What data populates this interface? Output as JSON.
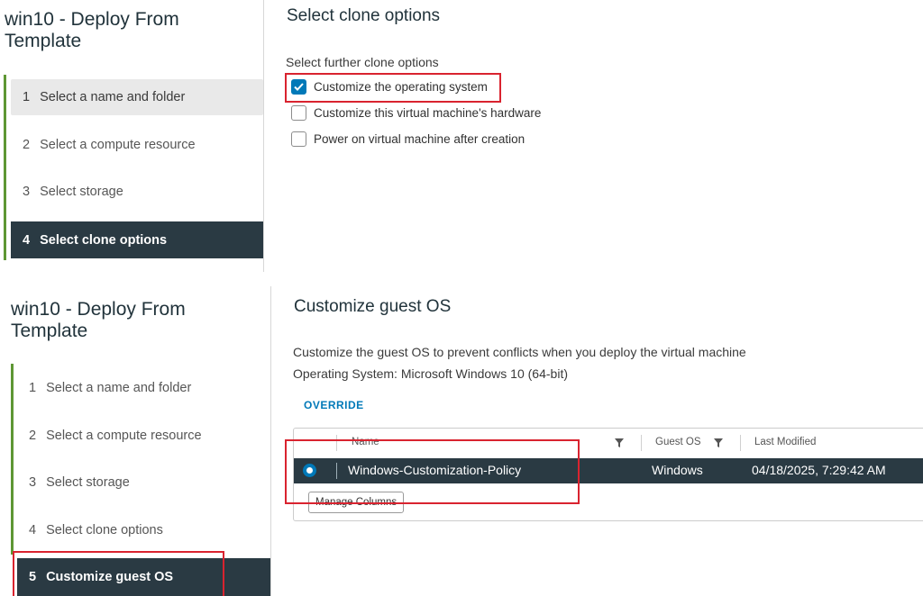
{
  "top": {
    "wizard_title_line1": "win10 - Deploy From",
    "wizard_title_line2": "Template",
    "steps": [
      {
        "num": "1",
        "label": "Select a name and folder"
      },
      {
        "num": "2",
        "label": "Select a compute resource"
      },
      {
        "num": "3",
        "label": "Select storage"
      },
      {
        "num": "4",
        "label": "Select clone options"
      }
    ],
    "section_title": "Select clone options",
    "subtitle": "Select further clone options",
    "options": [
      {
        "label": "Customize the operating system",
        "checked": true
      },
      {
        "label": "Customize this virtual machine's hardware",
        "checked": false
      },
      {
        "label": "Power on virtual machine after creation",
        "checked": false
      }
    ]
  },
  "bottom": {
    "wizard_title_line1": "win10 - Deploy From",
    "wizard_title_line2": "Template",
    "steps": [
      {
        "num": "1",
        "label": "Select a name and folder"
      },
      {
        "num": "2",
        "label": "Select a compute resource"
      },
      {
        "num": "3",
        "label": "Select storage"
      },
      {
        "num": "4",
        "label": "Select clone options"
      },
      {
        "num": "5",
        "label": "Customize guest OS"
      }
    ],
    "section_title": "Customize guest OS",
    "description": "Customize the guest OS to prevent conflicts when you deploy the virtual machine",
    "os_line": "Operating System: Microsoft Windows 10 (64-bit)",
    "override_label": "OVERRIDE",
    "table": {
      "columns": [
        "Name",
        "Guest OS",
        "Last Modified"
      ],
      "rows": [
        {
          "name": "Windows-Customization-Policy",
          "guest_os": "Windows",
          "last_modified": "04/18/2025, 7:29:42 AM",
          "selected": true
        }
      ]
    },
    "manage_columns_label": "Manage Columns"
  },
  "colors": {
    "accent_blue": "#0079b8",
    "active_step_bg": "#2a3a43",
    "progress_green": "#5e9734",
    "highlight_red": "#d9232f"
  },
  "icons": [
    "checkmark-icon",
    "filter-icon",
    "radio-selected-icon"
  ]
}
